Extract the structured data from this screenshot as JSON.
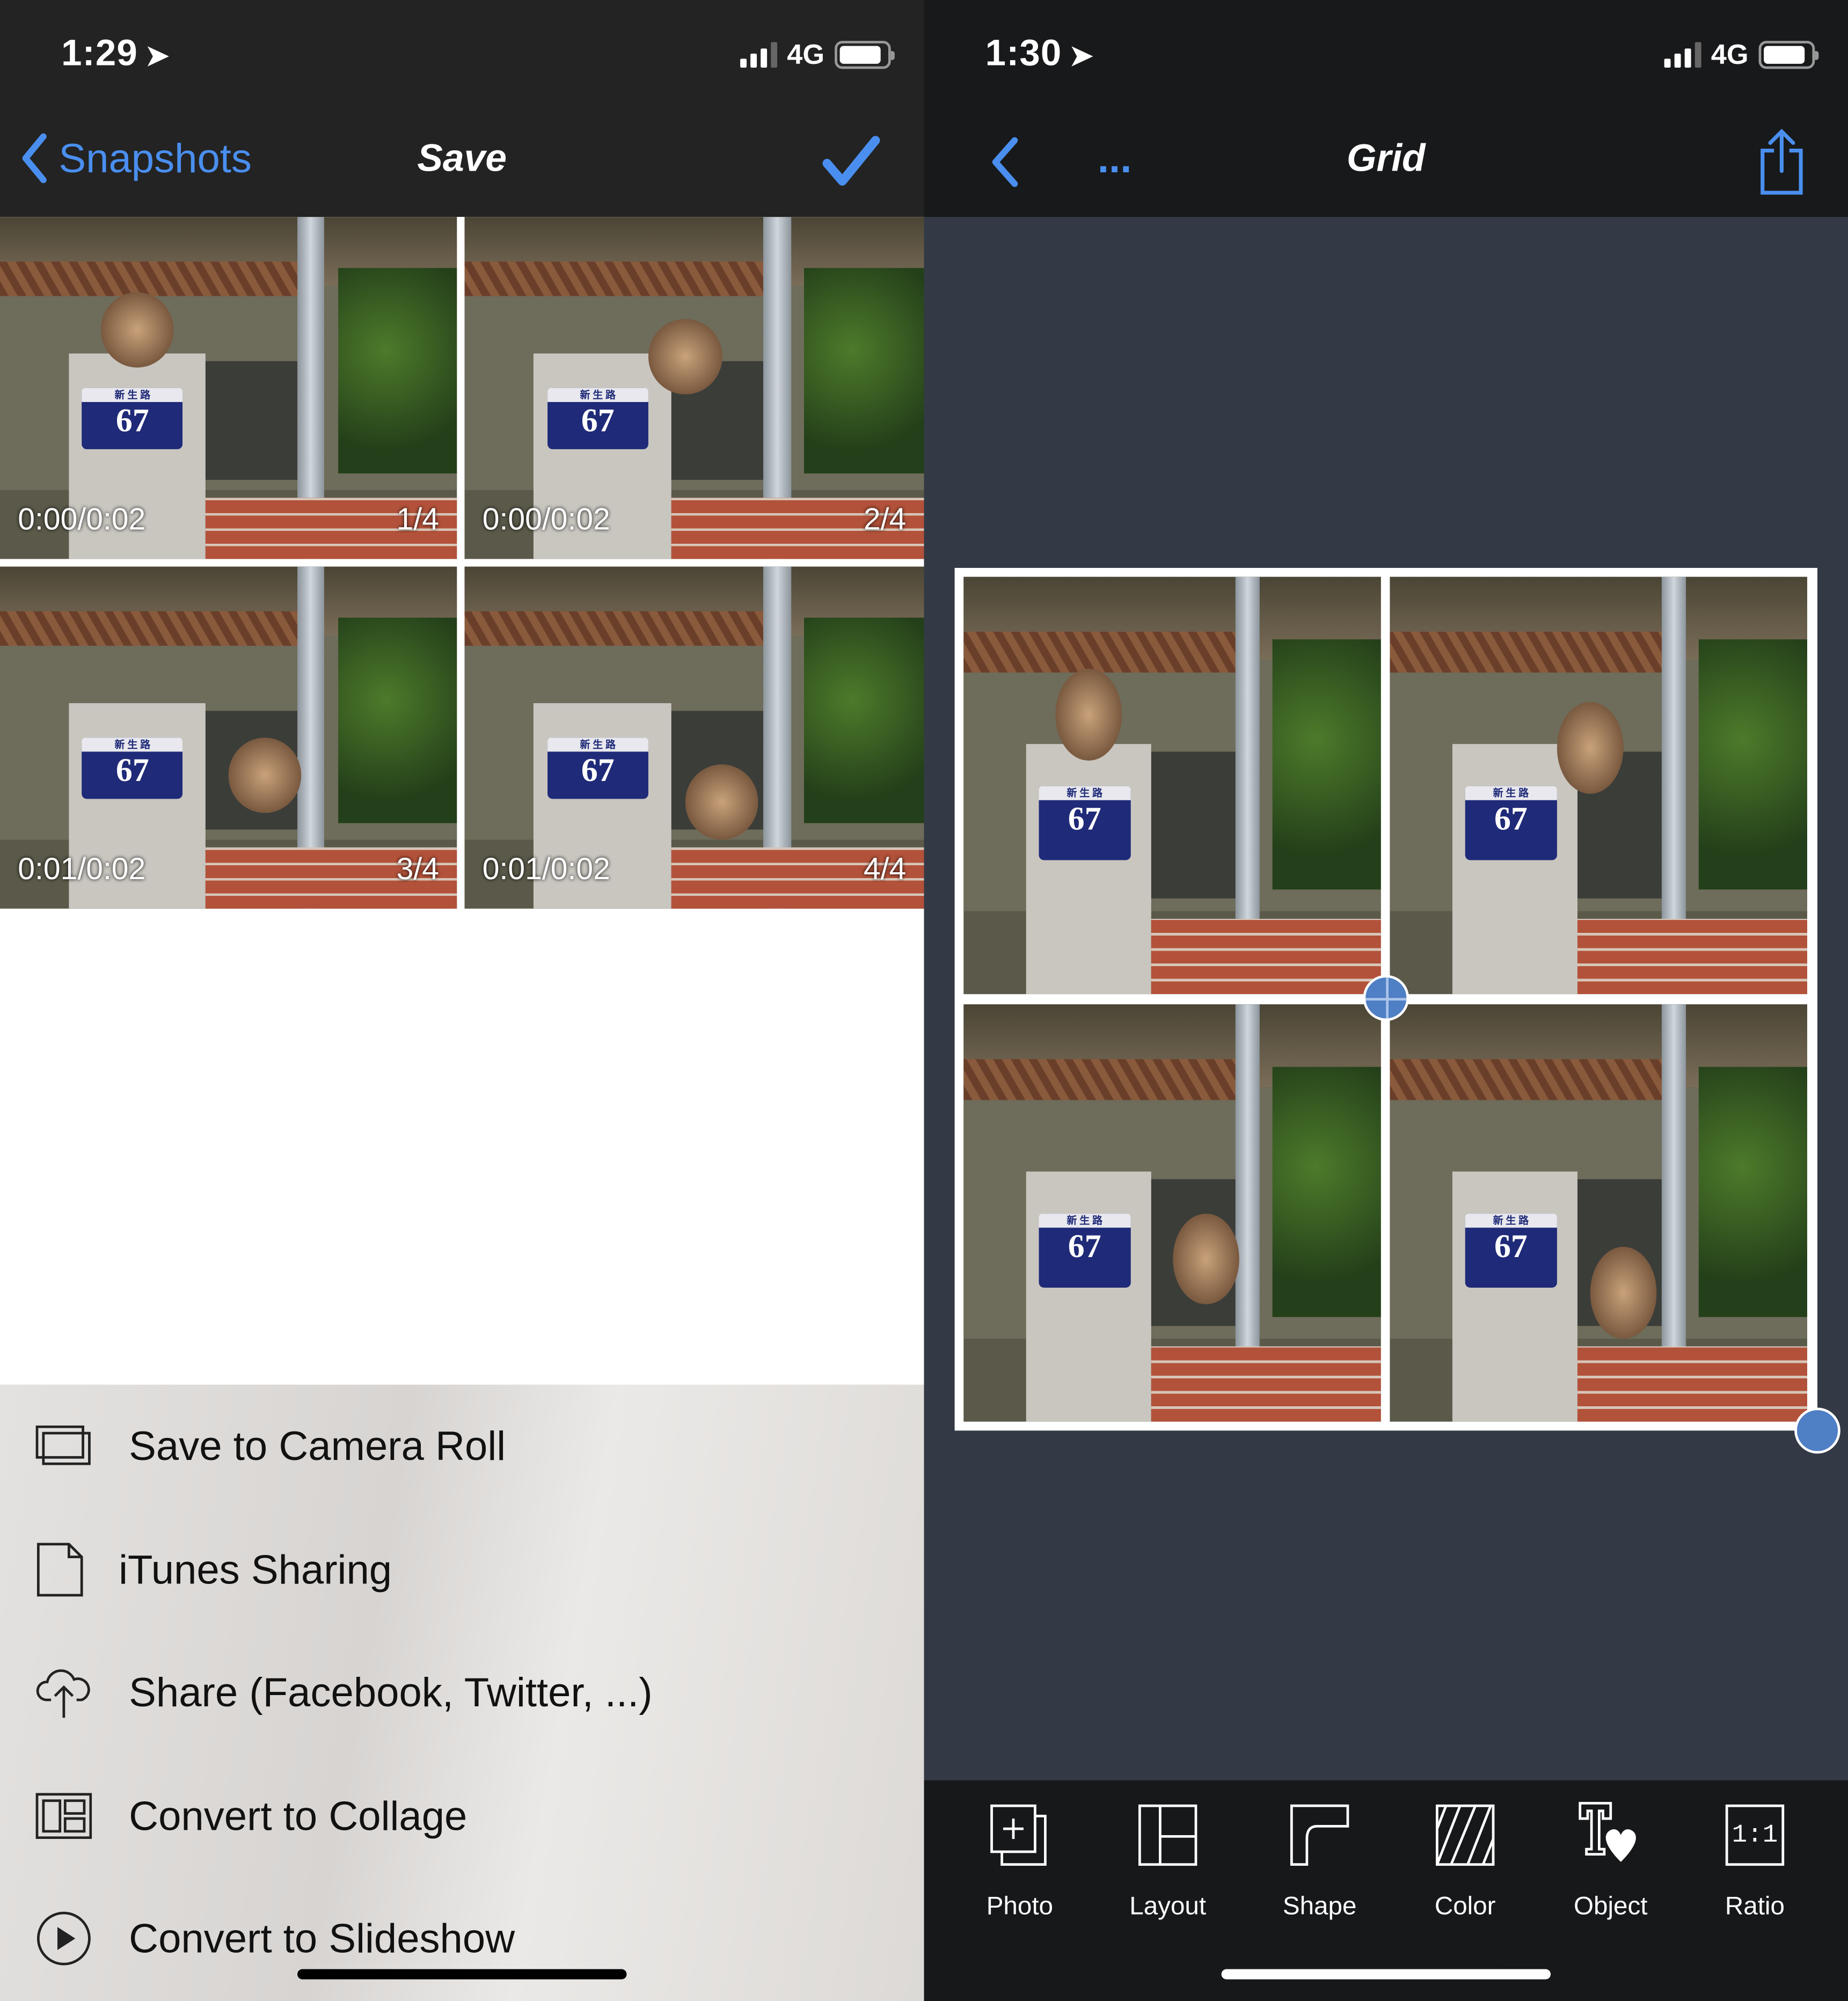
{
  "left": {
    "status": {
      "time": "1:29",
      "network": "4G",
      "battery_level": 0.9
    },
    "nav": {
      "back_label": "Snapshots",
      "title": "Save",
      "confirm_icon": "checkmark-icon"
    },
    "sign": {
      "top": "新 生 路",
      "number": "67"
    },
    "snapshots": [
      {
        "timestamp": "0:00/0:02",
        "index": "1/4"
      },
      {
        "timestamp": "0:00/0:02",
        "index": "2/4"
      },
      {
        "timestamp": "0:01/0:02",
        "index": "3/4"
      },
      {
        "timestamp": "0:01/0:02",
        "index": "4/4"
      }
    ],
    "actions": [
      {
        "label": "Save to Camera Roll",
        "icon": "camera-roll-icon"
      },
      {
        "label": "iTunes Sharing",
        "icon": "document-icon"
      },
      {
        "label": "Share (Facebook, Twitter, ...)",
        "icon": "cloud-upload-icon"
      },
      {
        "label": "Convert to Collage",
        "icon": "collage-icon"
      },
      {
        "label": "Convert to Slideshow",
        "icon": "play-icon"
      }
    ]
  },
  "right": {
    "status": {
      "time": "1:30",
      "network": "4G",
      "battery_level": 0.9
    },
    "nav": {
      "more_label": "...",
      "title": "Grid",
      "share_icon": "share-icon"
    },
    "toolbar": [
      {
        "label": "Photo",
        "icon": "add-photo-icon"
      },
      {
        "label": "Layout",
        "icon": "layout-icon"
      },
      {
        "label": "Shape",
        "icon": "shape-icon"
      },
      {
        "label": "Color",
        "icon": "color-icon"
      },
      {
        "label": "Object",
        "icon": "object-icon"
      },
      {
        "label": "Ratio",
        "icon": "ratio-icon",
        "glyph": "1:1"
      }
    ]
  },
  "colors": {
    "accent": "#4a8ff0",
    "handle": "#4f7fc4",
    "canvas_bg": "#333a45"
  }
}
